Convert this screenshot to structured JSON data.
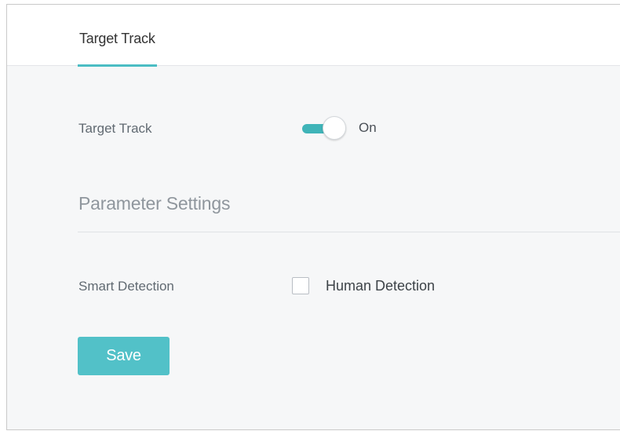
{
  "tabs": [
    {
      "label": "Target Track",
      "active": true
    }
  ],
  "target_track": {
    "label": "Target Track",
    "toggle_on": true,
    "state_text": "On"
  },
  "parameter_settings": {
    "title": "Parameter Settings",
    "smart_detection": {
      "label": "Smart Detection",
      "option_label": "Human Detection",
      "checked": false
    }
  },
  "actions": {
    "save_label": "Save"
  },
  "colors": {
    "accent": "#4bbdc4",
    "toggle_track": "#3fb4b8",
    "button": "#52c1c8",
    "content_bg": "#f6f7f8"
  }
}
